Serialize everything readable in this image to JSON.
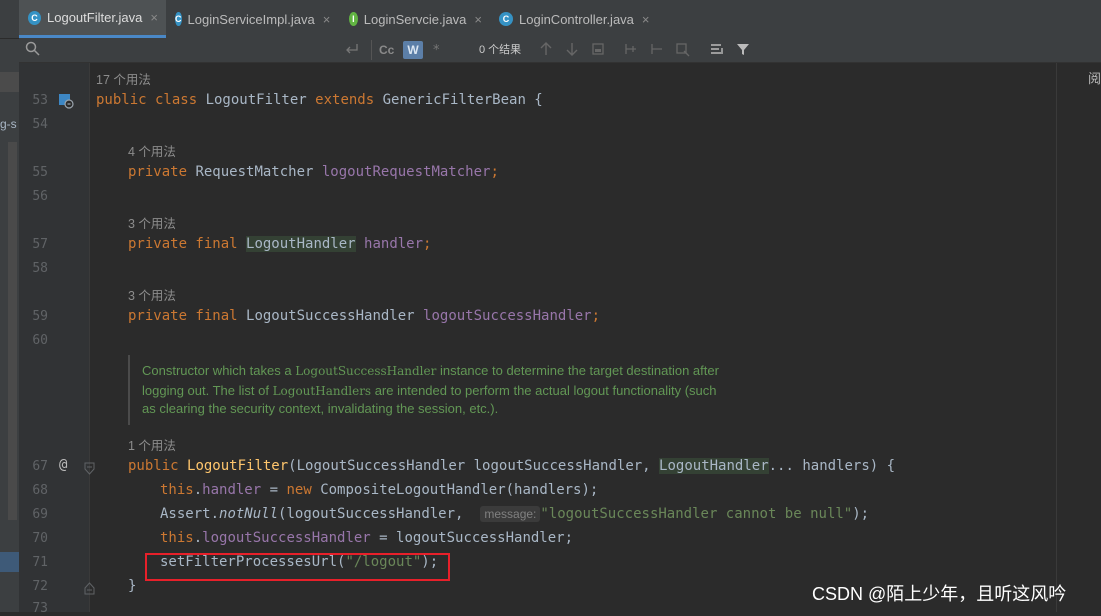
{
  "tabs": [
    {
      "label": "LogoutFilter.java",
      "icon": "class-icon",
      "letter": "C",
      "active": true
    },
    {
      "label": "LoginServiceImpl.java",
      "icon": "class-icon",
      "letter": "C",
      "active": false
    },
    {
      "label": "LoginServcie.java",
      "icon": "interface-icon",
      "letter": "I",
      "active": false
    },
    {
      "label": "LoginController.java",
      "icon": "class-icon",
      "letter": "C",
      "active": false
    }
  ],
  "close_glyph": "×",
  "search": {
    "cc_label": "Cc",
    "w_label": "W",
    "result_count": "0 个结果"
  },
  "left_panel_fragment": "g-s",
  "right_panel_fragment": "阅",
  "usages": {
    "u53": "17 个用法",
    "u55": "4 个用法",
    "u57": "3 个用法",
    "u59": "3 个用法",
    "u67": "1 个用法"
  },
  "line_numbers": {
    "l53": "53",
    "l54": "54",
    "l55": "55",
    "l56": "56",
    "l57": "57",
    "l58": "58",
    "l59": "59",
    "l60": "60",
    "l67": "67",
    "l68": "68",
    "l69": "69",
    "l70": "70",
    "l71": "71",
    "l72": "72",
    "l73": "73"
  },
  "gutter_marks": {
    "at_symbol": "@"
  },
  "code": {
    "l53": {
      "k1": "public class ",
      "t1": "LogoutFilter ",
      "k2": "extends ",
      "t2": "GenericFilterBean {"
    },
    "l55": {
      "k1": "private ",
      "t1": "RequestMatcher ",
      "f1": "logoutRequestMatcher",
      "p1": ";"
    },
    "l57": {
      "k1": "private final ",
      "t1": "LogoutHandler",
      "sp": " ",
      "f1": "handler",
      "p1": ";"
    },
    "l59": {
      "k1": "private final ",
      "t1": "LogoutSuccessHandler ",
      "f1": "logoutSuccessHandler",
      "p1": ";"
    },
    "l67": {
      "k1": "public ",
      "m1": "LogoutFilter",
      "t1": "(LogoutSuccessHandler logoutSuccessHandler, ",
      "t2": "LogoutHandler",
      "t3": "... handlers) {"
    },
    "l68": {
      "k1": "this",
      "p1": ".",
      "f1": "handler",
      "p2": " = ",
      "k2": "new ",
      "t1": "CompositeLogoutHandler(handlers);"
    },
    "l69": {
      "t1": "Assert.",
      "m1": "notNull",
      "t2": "(logoutSuccessHandler, ",
      "hint": "message:",
      "s1": "\"logoutSuccessHandler cannot be null\"",
      "t3": ");"
    },
    "l70": {
      "k1": "this",
      "p1": ".",
      "f1": "logoutSuccessHandler",
      "t1": " = logoutSuccessHandler;"
    },
    "l71": {
      "t1": "setFilterProcessesUrl(",
      "s1": "\"/logout\"",
      "t2": ");"
    },
    "l72": {
      "t1": "}"
    }
  },
  "doc": {
    "line1_a": "Constructor which takes a ",
    "line1_code": "LogoutSuccessHandler",
    "line1_b": " instance to determine the target destination after",
    "line2_a": "logging out. The list of ",
    "line2_code": "LogoutHandlers",
    "line2_b": " are intended to perform the actual logout functionality (such",
    "line3": "as clearing the security context, invalidating the session, etc.)."
  },
  "watermark": "CSDN @陌上少年，且听这风吟",
  "colors": {
    "background": "#2b2b2b",
    "keyword": "#cc7832",
    "field": "#9876aa",
    "method": "#ffc66d",
    "string": "#6a8759",
    "doc": "#629755",
    "highlight_box": "#e8202a"
  }
}
